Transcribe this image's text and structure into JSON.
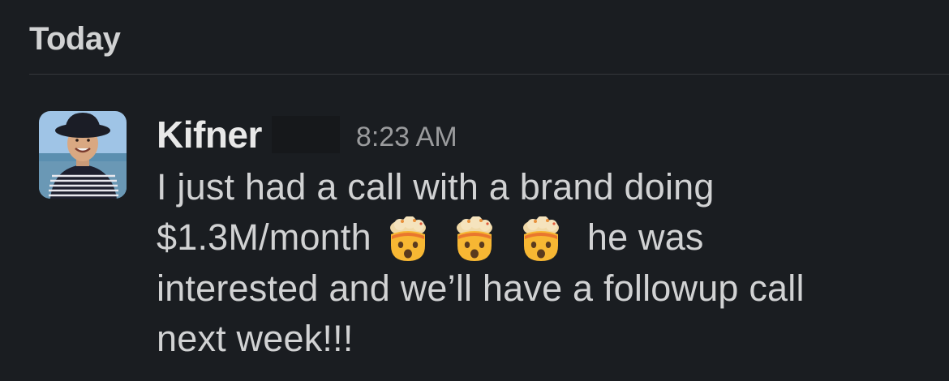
{
  "channel": {
    "day_divider": "Today"
  },
  "message": {
    "author": "Kifner",
    "timestamp": "8:23 AM",
    "text_line1": "I just had a call with a brand doing",
    "text_line2_a": "$1.3M/month",
    "text_line2_b": "he was",
    "text_line3": "interested and we’ll have a followup call",
    "text_line4": "next week!!!",
    "emojis": [
      "exploding-head",
      "exploding-head",
      "exploding-head"
    ]
  },
  "colors": {
    "background": "#1a1d21",
    "text": "#d1d2d3",
    "muted": "#9a9b9d"
  }
}
